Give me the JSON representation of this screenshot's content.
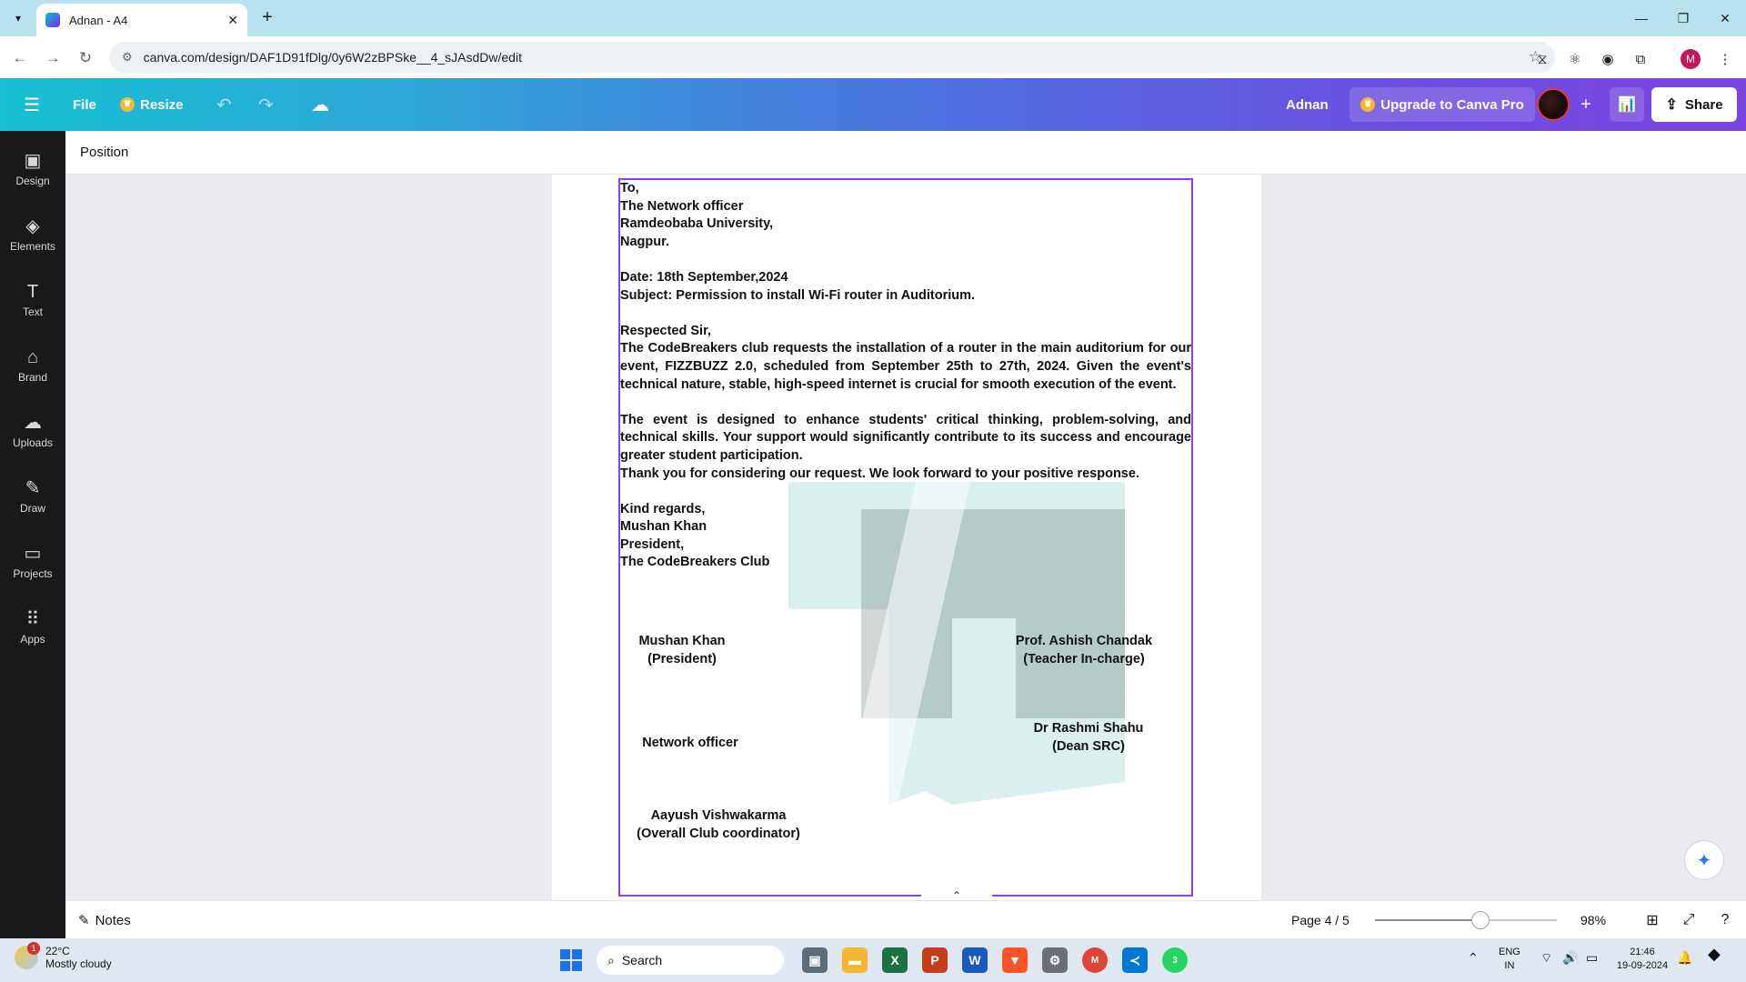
{
  "browser": {
    "tab_title": "Adnan - A4",
    "url": "canva.com/design/DAF1D91fDlg/0y6W2zBPSke__4_sJAsdDw/edit",
    "profile_initial": "M"
  },
  "canva_header": {
    "file_label": "File",
    "resize_label": "Resize",
    "user_name": "Adnan",
    "upgrade_label": "Upgrade to Canva Pro",
    "share_label": "Share"
  },
  "sidebar": {
    "items": [
      {
        "label": "Design",
        "icon": "design-icon"
      },
      {
        "label": "Elements",
        "icon": "elements-icon"
      },
      {
        "label": "Text",
        "icon": "text-icon"
      },
      {
        "label": "Brand",
        "icon": "brand-icon"
      },
      {
        "label": "Uploads",
        "icon": "uploads-icon"
      },
      {
        "label": "Draw",
        "icon": "draw-icon"
      },
      {
        "label": "Projects",
        "icon": "projects-icon"
      },
      {
        "label": "Apps",
        "icon": "apps-icon"
      }
    ]
  },
  "toolbar": {
    "position_label": "Position"
  },
  "letter": {
    "to_lines": [
      "To,",
      "The Network officer",
      "Ramdeobaba University,",
      "Nagpur."
    ],
    "date": "Date:  18th September,2024",
    "subject": "Subject: Permission to install Wi-Fi router in Auditorium.",
    "salutation": "Respected Sir,",
    "para1": "The CodeBreakers club requests the installation of a router in the main auditorium for our event, FIZZBUZZ 2.0, scheduled from September 25th to 27th, 2024. Given the event's technical nature, stable, high-speed internet is crucial for smooth execution of the event.",
    "para2": "The event is designed to enhance students' critical thinking, problem-solving, and technical skills. Your support would significantly contribute to its success and encourage greater student participation.",
    "para3": "Thank you for considering our request. We look forward to your positive response.",
    "closing_lines": [
      "Kind regards,",
      "Mushan Khan",
      "President,",
      "The CodeBreakers Club"
    ]
  },
  "signatures": {
    "s1_name": "Mushan Khan",
    "s1_role": "(President)",
    "s2_name": "Prof. Ashish Chandak",
    "s2_role": "(Teacher In-charge)",
    "s3_name": "Network officer",
    "s4_name": "Dr Rashmi Shahu",
    "s4_role": "(Dean SRC)",
    "s5_name": "Aayush Vishwakarma",
    "s5_role": "(Overall Club coordinator)"
  },
  "footer": {
    "notes_label": "Notes",
    "page_indicator": "Page 4 / 5",
    "zoom_level": "98%",
    "zoom_slider_fraction": 0.58
  },
  "taskbar": {
    "temperature": "22°C",
    "weather": "Mostly cloudy",
    "weather_badge": "1",
    "search_label": "Search",
    "language": "ENG",
    "region": "IN",
    "time": "21:46",
    "date": "19-09-2024",
    "whatsapp_badge": "3",
    "chrome_badge": "M"
  },
  "colors": {
    "selection": "#8b3dff",
    "canva_gradient_start": "#17c0d2",
    "canva_gradient_end": "#7a45df",
    "sidebar_bg": "#18191b"
  }
}
